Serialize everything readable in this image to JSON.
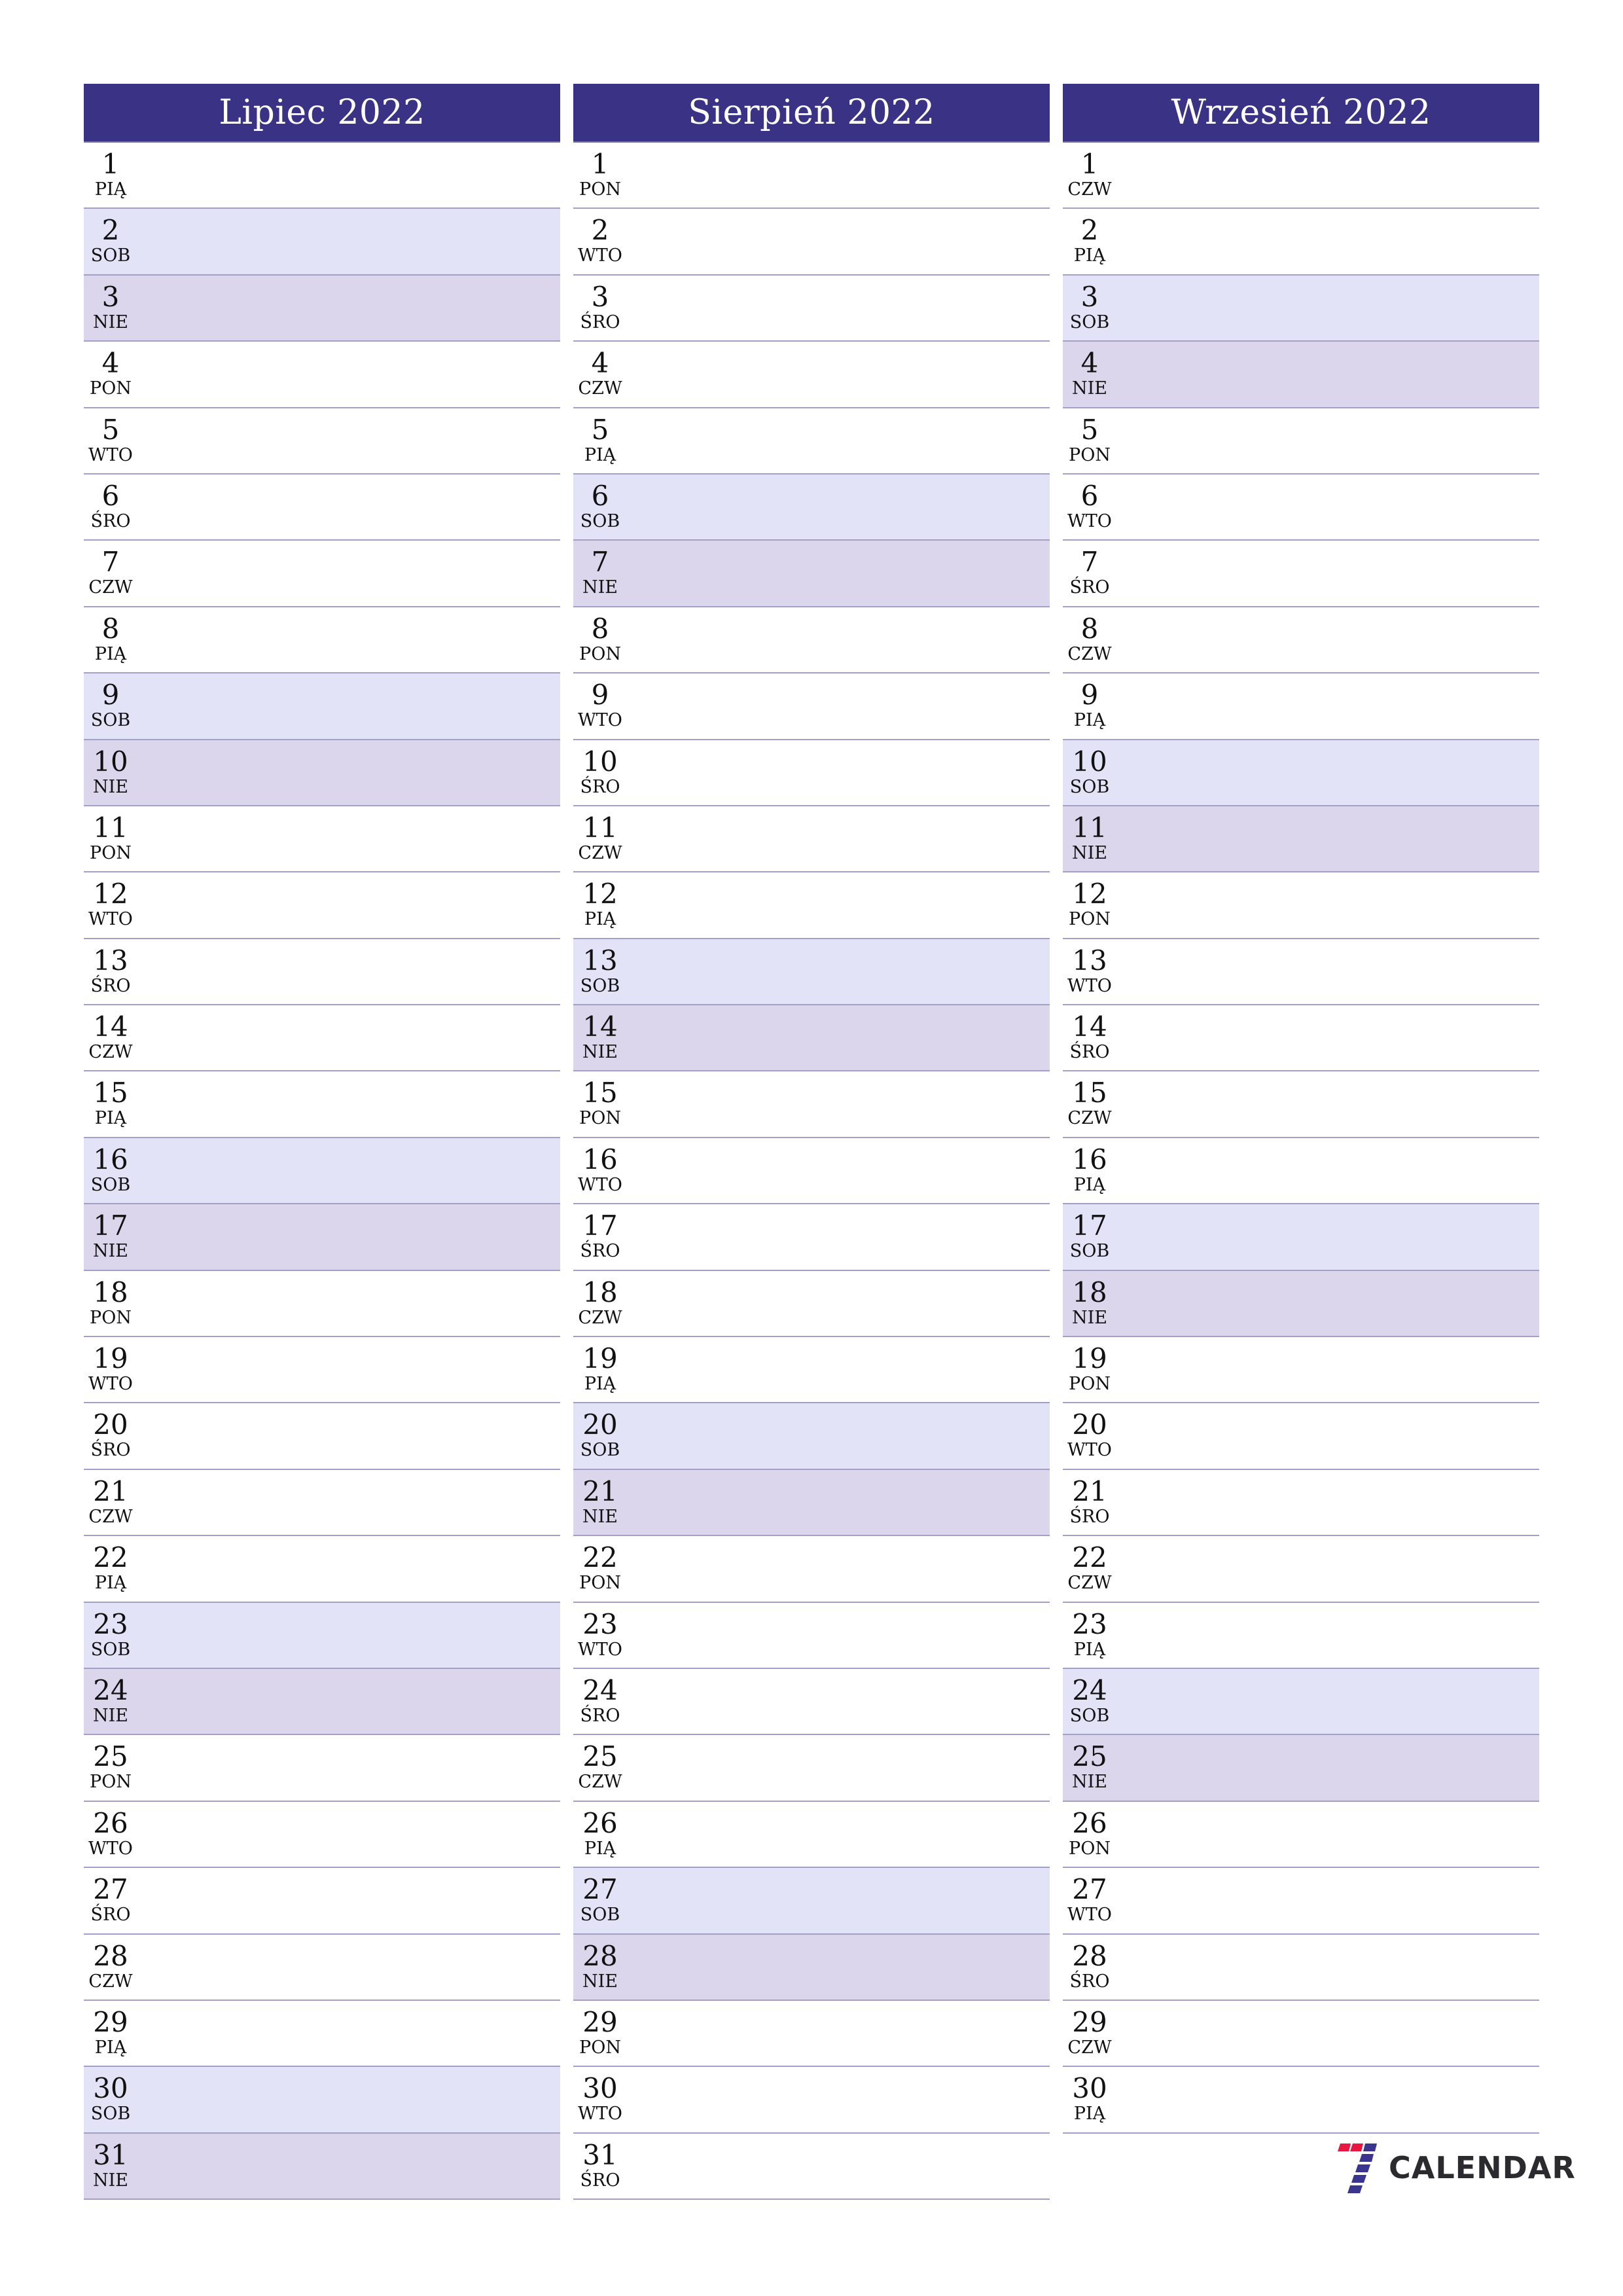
{
  "months": [
    {
      "title": "Lipiec 2022",
      "days": [
        {
          "d": "1",
          "w": "PIĄ",
          "t": ""
        },
        {
          "d": "2",
          "w": "SOB",
          "t": "sat"
        },
        {
          "d": "3",
          "w": "NIE",
          "t": "sun"
        },
        {
          "d": "4",
          "w": "PON",
          "t": ""
        },
        {
          "d": "5",
          "w": "WTO",
          "t": ""
        },
        {
          "d": "6",
          "w": "ŚRO",
          "t": ""
        },
        {
          "d": "7",
          "w": "CZW",
          "t": ""
        },
        {
          "d": "8",
          "w": "PIĄ",
          "t": ""
        },
        {
          "d": "9",
          "w": "SOB",
          "t": "sat"
        },
        {
          "d": "10",
          "w": "NIE",
          "t": "sun"
        },
        {
          "d": "11",
          "w": "PON",
          "t": ""
        },
        {
          "d": "12",
          "w": "WTO",
          "t": ""
        },
        {
          "d": "13",
          "w": "ŚRO",
          "t": ""
        },
        {
          "d": "14",
          "w": "CZW",
          "t": ""
        },
        {
          "d": "15",
          "w": "PIĄ",
          "t": ""
        },
        {
          "d": "16",
          "w": "SOB",
          "t": "sat"
        },
        {
          "d": "17",
          "w": "NIE",
          "t": "sun"
        },
        {
          "d": "18",
          "w": "PON",
          "t": ""
        },
        {
          "d": "19",
          "w": "WTO",
          "t": ""
        },
        {
          "d": "20",
          "w": "ŚRO",
          "t": ""
        },
        {
          "d": "21",
          "w": "CZW",
          "t": ""
        },
        {
          "d": "22",
          "w": "PIĄ",
          "t": ""
        },
        {
          "d": "23",
          "w": "SOB",
          "t": "sat"
        },
        {
          "d": "24",
          "w": "NIE",
          "t": "sun"
        },
        {
          "d": "25",
          "w": "PON",
          "t": ""
        },
        {
          "d": "26",
          "w": "WTO",
          "t": ""
        },
        {
          "d": "27",
          "w": "ŚRO",
          "t": ""
        },
        {
          "d": "28",
          "w": "CZW",
          "t": ""
        },
        {
          "d": "29",
          "w": "PIĄ",
          "t": ""
        },
        {
          "d": "30",
          "w": "SOB",
          "t": "sat"
        },
        {
          "d": "31",
          "w": "NIE",
          "t": "sun"
        }
      ]
    },
    {
      "title": "Sierpień 2022",
      "days": [
        {
          "d": "1",
          "w": "PON",
          "t": ""
        },
        {
          "d": "2",
          "w": "WTO",
          "t": ""
        },
        {
          "d": "3",
          "w": "ŚRO",
          "t": ""
        },
        {
          "d": "4",
          "w": "CZW",
          "t": ""
        },
        {
          "d": "5",
          "w": "PIĄ",
          "t": ""
        },
        {
          "d": "6",
          "w": "SOB",
          "t": "sat"
        },
        {
          "d": "7",
          "w": "NIE",
          "t": "sun"
        },
        {
          "d": "8",
          "w": "PON",
          "t": ""
        },
        {
          "d": "9",
          "w": "WTO",
          "t": ""
        },
        {
          "d": "10",
          "w": "ŚRO",
          "t": ""
        },
        {
          "d": "11",
          "w": "CZW",
          "t": ""
        },
        {
          "d": "12",
          "w": "PIĄ",
          "t": ""
        },
        {
          "d": "13",
          "w": "SOB",
          "t": "sat"
        },
        {
          "d": "14",
          "w": "NIE",
          "t": "sun"
        },
        {
          "d": "15",
          "w": "PON",
          "t": ""
        },
        {
          "d": "16",
          "w": "WTO",
          "t": ""
        },
        {
          "d": "17",
          "w": "ŚRO",
          "t": ""
        },
        {
          "d": "18",
          "w": "CZW",
          "t": ""
        },
        {
          "d": "19",
          "w": "PIĄ",
          "t": ""
        },
        {
          "d": "20",
          "w": "SOB",
          "t": "sat"
        },
        {
          "d": "21",
          "w": "NIE",
          "t": "sun"
        },
        {
          "d": "22",
          "w": "PON",
          "t": ""
        },
        {
          "d": "23",
          "w": "WTO",
          "t": ""
        },
        {
          "d": "24",
          "w": "ŚRO",
          "t": ""
        },
        {
          "d": "25",
          "w": "CZW",
          "t": ""
        },
        {
          "d": "26",
          "w": "PIĄ",
          "t": ""
        },
        {
          "d": "27",
          "w": "SOB",
          "t": "sat"
        },
        {
          "d": "28",
          "w": "NIE",
          "t": "sun"
        },
        {
          "d": "29",
          "w": "PON",
          "t": ""
        },
        {
          "d": "30",
          "w": "WTO",
          "t": ""
        },
        {
          "d": "31",
          "w": "ŚRO",
          "t": ""
        }
      ]
    },
    {
      "title": "Wrzesień 2022",
      "days": [
        {
          "d": "1",
          "w": "CZW",
          "t": ""
        },
        {
          "d": "2",
          "w": "PIĄ",
          "t": ""
        },
        {
          "d": "3",
          "w": "SOB",
          "t": "sat"
        },
        {
          "d": "4",
          "w": "NIE",
          "t": "sun"
        },
        {
          "d": "5",
          "w": "PON",
          "t": ""
        },
        {
          "d": "6",
          "w": "WTO",
          "t": ""
        },
        {
          "d": "7",
          "w": "ŚRO",
          "t": ""
        },
        {
          "d": "8",
          "w": "CZW",
          "t": ""
        },
        {
          "d": "9",
          "w": "PIĄ",
          "t": ""
        },
        {
          "d": "10",
          "w": "SOB",
          "t": "sat"
        },
        {
          "d": "11",
          "w": "NIE",
          "t": "sun"
        },
        {
          "d": "12",
          "w": "PON",
          "t": ""
        },
        {
          "d": "13",
          "w": "WTO",
          "t": ""
        },
        {
          "d": "14",
          "w": "ŚRO",
          "t": ""
        },
        {
          "d": "15",
          "w": "CZW",
          "t": ""
        },
        {
          "d": "16",
          "w": "PIĄ",
          "t": ""
        },
        {
          "d": "17",
          "w": "SOB",
          "t": "sat"
        },
        {
          "d": "18",
          "w": "NIE",
          "t": "sun"
        },
        {
          "d": "19",
          "w": "PON",
          "t": ""
        },
        {
          "d": "20",
          "w": "WTO",
          "t": ""
        },
        {
          "d": "21",
          "w": "ŚRO",
          "t": ""
        },
        {
          "d": "22",
          "w": "CZW",
          "t": ""
        },
        {
          "d": "23",
          "w": "PIĄ",
          "t": ""
        },
        {
          "d": "24",
          "w": "SOB",
          "t": "sat"
        },
        {
          "d": "25",
          "w": "NIE",
          "t": "sun"
        },
        {
          "d": "26",
          "w": "PON",
          "t": ""
        },
        {
          "d": "27",
          "w": "WTO",
          "t": ""
        },
        {
          "d": "28",
          "w": "ŚRO",
          "t": ""
        },
        {
          "d": "29",
          "w": "CZW",
          "t": ""
        },
        {
          "d": "30",
          "w": "PIĄ",
          "t": ""
        }
      ]
    }
  ],
  "logo": {
    "text": "CALENDAR",
    "icon": "seven-stripes-icon"
  },
  "colors": {
    "header_bg": "#3a3284",
    "saturday_bg": "#e3e3f8",
    "sunday_bg": "#dcd6ec",
    "logo_red": "#e8173f",
    "logo_blue": "#3b358f"
  }
}
